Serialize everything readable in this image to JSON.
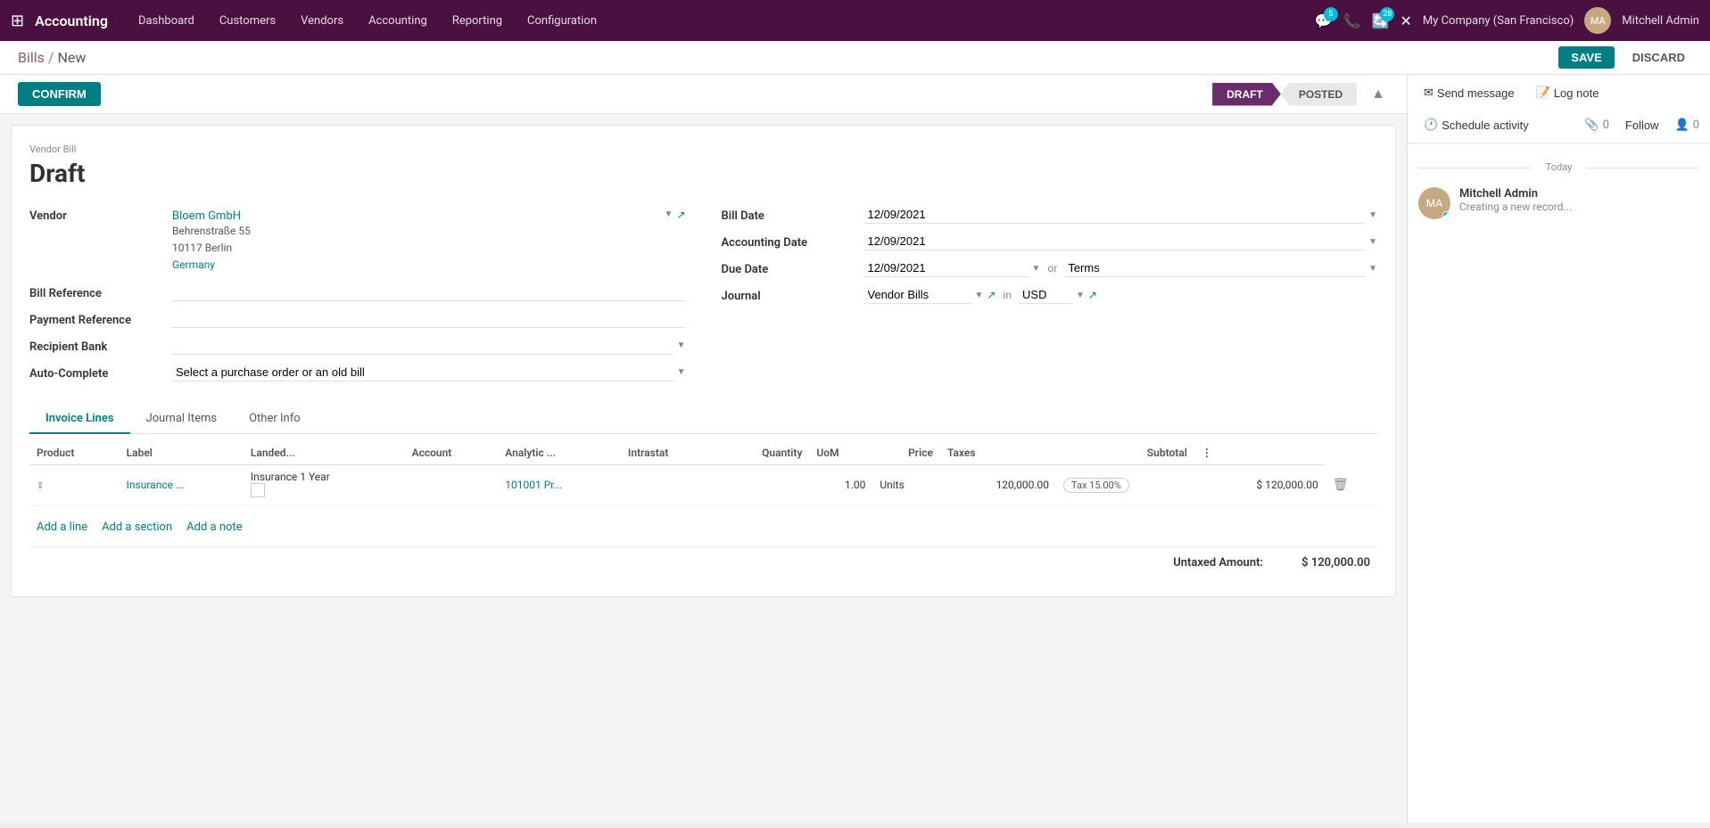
{
  "app": {
    "name": "Accounting"
  },
  "nav": {
    "items": [
      "Dashboard",
      "Customers",
      "Vendors",
      "Accounting",
      "Reporting",
      "Configuration"
    ]
  },
  "topbar": {
    "badge_chat": "5",
    "badge_activity": "28",
    "company": "My Company (San Francisco)",
    "user": "Mitchell Admin"
  },
  "breadcrumb": {
    "parent": "Bills",
    "sep": "/",
    "current": "New"
  },
  "buttons": {
    "save": "SAVE",
    "discard": "DISCARD",
    "confirm": "CONFIRM",
    "follow": "Follow",
    "schedule_activity": "Schedule activity",
    "send_message": "Send message",
    "log_note": "Log note",
    "add_line": "Add a line",
    "add_section": "Add a section",
    "add_note": "Add a note"
  },
  "stages": {
    "draft": "DRAFT",
    "posted": "POSTED"
  },
  "form": {
    "bill_label": "Vendor Bill",
    "bill_title": "Draft",
    "vendor_label": "Vendor",
    "vendor_value": "Bloem GmbH",
    "vendor_address_line1": "Behrenstraße 55",
    "vendor_address_line2": "10117 Berlin",
    "vendor_address_country": "Germany",
    "bill_reference_label": "Bill Reference",
    "payment_reference_label": "Payment Reference",
    "recipient_bank_label": "Recipient Bank",
    "auto_complete_label": "Auto-Complete",
    "auto_complete_placeholder": "Select a purchase order or an old bill",
    "bill_date_label": "Bill Date",
    "bill_date_value": "12/09/2021",
    "accounting_date_label": "Accounting Date",
    "accounting_date_value": "12/09/2021",
    "due_date_label": "Due Date",
    "due_date_value": "12/09/2021",
    "due_date_or": "or",
    "terms_placeholder": "Terms",
    "journal_label": "Journal",
    "journal_value": "Vendor Bills",
    "journal_in": "in",
    "currency_value": "USD"
  },
  "tabs": {
    "items": [
      "Invoice Lines",
      "Journal Items",
      "Other Info"
    ],
    "active": 0
  },
  "table": {
    "columns": [
      "Product",
      "Label",
      "Landed...",
      "Account",
      "Analytic ...",
      "Intrastat",
      "Quantity",
      "UoM",
      "Price",
      "Taxes",
      "Subtotal"
    ],
    "rows": [
      {
        "product": "Insurance ...",
        "label": "Insurance 1 Year",
        "landed": "",
        "account": "101001 Pr...",
        "analytic": "",
        "intrastat": "",
        "quantity": "1.00",
        "uom": "Units",
        "price": "120,000.00",
        "taxes": "Tax 15.00%",
        "subtotal": "$ 120,000.00"
      }
    ]
  },
  "totals": {
    "untaxed_label": "Untaxed Amount:",
    "untaxed_value": "$ 120,000.00"
  },
  "chatter": {
    "counts": {
      "paperclip": "0",
      "follow": "Follow",
      "person": "0"
    },
    "day_divider": "Today",
    "messages": [
      {
        "author": "Mitchell Admin",
        "avatar_initials": "MA",
        "text": "Creating a new record..."
      }
    ]
  }
}
